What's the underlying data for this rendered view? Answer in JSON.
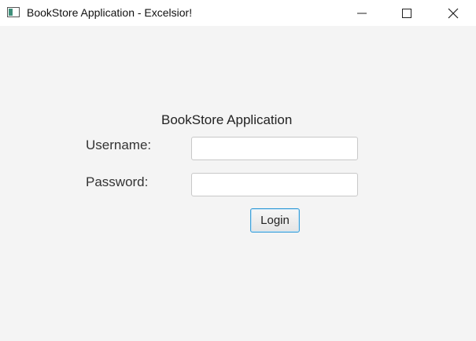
{
  "window": {
    "title": "BookStore Application - Excelsior!",
    "icon": "java-app-window-icon",
    "controls": [
      "minimize",
      "maximize",
      "close"
    ]
  },
  "form": {
    "heading": "BookStore Application",
    "username_label": "Username:",
    "username_value": "",
    "password_label": "Password:",
    "password_value": "",
    "login_label": "Login"
  },
  "colors": {
    "background": "#f4f4f4",
    "titlebar": "#ffffff",
    "button_focus_border": "#3a9fd8"
  }
}
